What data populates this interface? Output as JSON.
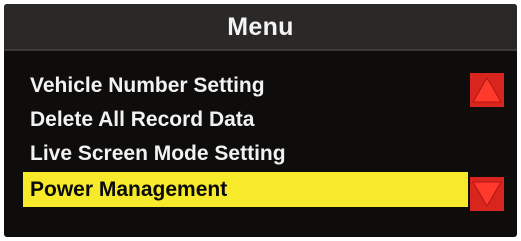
{
  "menu": {
    "title": "Menu",
    "items": [
      {
        "label": "Vehicle Number Setting",
        "selected": false
      },
      {
        "label": "Delete All Record Data",
        "selected": false
      },
      {
        "label": "Live Screen Mode Setting",
        "selected": false
      },
      {
        "label": "Power Management",
        "selected": true
      }
    ]
  },
  "scroll": {
    "up_icon": "triangle-up-icon",
    "down_icon": "triangle-down-icon"
  },
  "colors": {
    "screen_background": "#0e0d0c",
    "header_background": "#2a2927",
    "text": "#f2f2f2",
    "selection_highlight": "#f6ea2a",
    "scroll_button": "#d8251e"
  }
}
